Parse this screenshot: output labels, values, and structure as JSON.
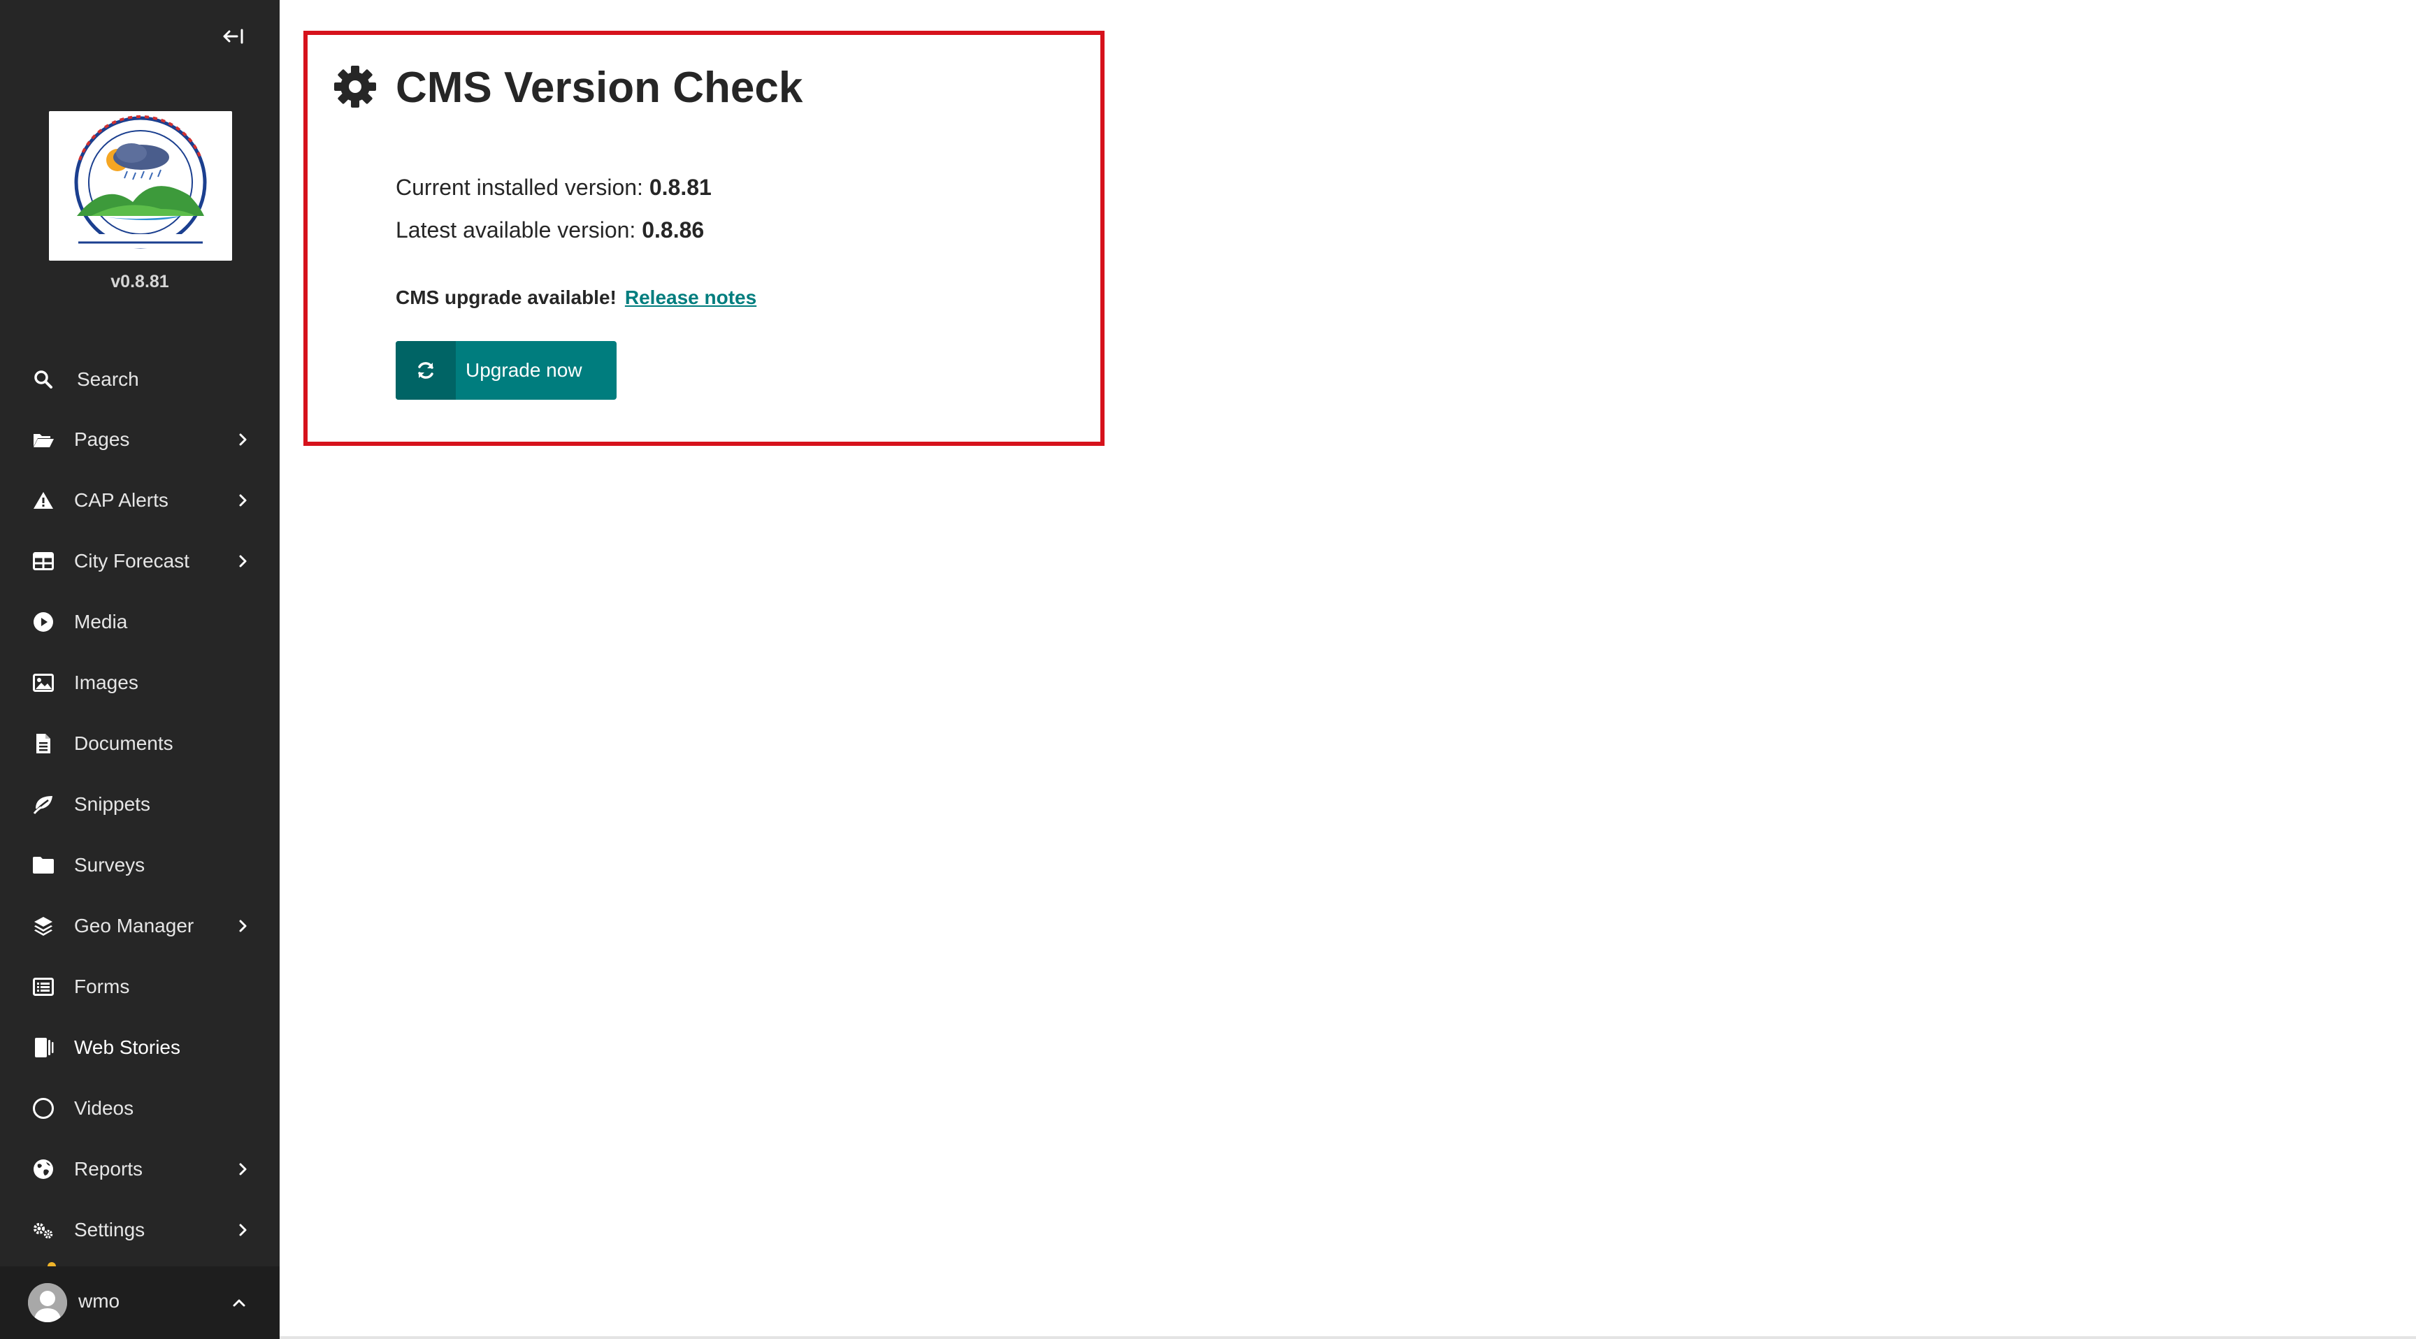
{
  "sidebar": {
    "version": "v0.8.81",
    "logo_alt": "Ethiopian Meteorology Institute",
    "items": [
      {
        "label": "Search",
        "icon": "search-icon",
        "has_submenu": false
      },
      {
        "label": "Pages",
        "icon": "folder-open-icon",
        "has_submenu": true
      },
      {
        "label": "CAP Alerts",
        "icon": "warning-icon",
        "has_submenu": true
      },
      {
        "label": "City Forecast",
        "icon": "table-icon",
        "has_submenu": true
      },
      {
        "label": "Media",
        "icon": "play-icon",
        "has_submenu": false
      },
      {
        "label": "Images",
        "icon": "image-icon",
        "has_submenu": false
      },
      {
        "label": "Documents",
        "icon": "document-icon",
        "has_submenu": false
      },
      {
        "label": "Snippets",
        "icon": "leaf-icon",
        "has_submenu": false
      },
      {
        "label": "Surveys",
        "icon": "folder-icon",
        "has_submenu": false
      },
      {
        "label": "Geo Manager",
        "icon": "layers-icon",
        "has_submenu": true
      },
      {
        "label": "Forms",
        "icon": "list-icon",
        "has_submenu": false
      },
      {
        "label": "Web Stories",
        "icon": "web-stories-icon",
        "has_submenu": false,
        "active": true
      },
      {
        "label": "Videos",
        "icon": "circle-icon",
        "has_submenu": false
      },
      {
        "label": "Reports",
        "icon": "globe-icon",
        "has_submenu": true
      },
      {
        "label": "Settings",
        "icon": "cogs-icon",
        "has_submenu": true
      }
    ],
    "account": {
      "username": "wmo"
    }
  },
  "main": {
    "title": "CMS Version Check",
    "current_label": "Current installed version: ",
    "current_value": "0.8.81",
    "latest_label": "Latest available version: ",
    "latest_value": "0.8.86",
    "upgrade_message": "CMS upgrade available!",
    "release_notes": "Release notes",
    "upgrade_button": "Upgrade now"
  },
  "colors": {
    "sidebar_bg": "#262626",
    "accent": "#007d7e",
    "highlight_border": "#d6121c"
  }
}
